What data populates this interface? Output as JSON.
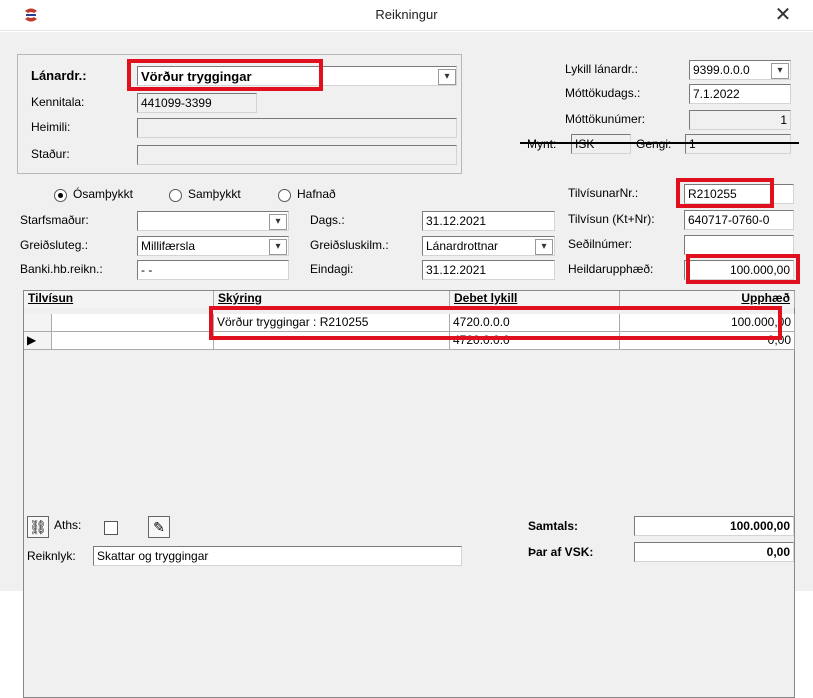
{
  "window": {
    "title": "Reikningur"
  },
  "creditor": {
    "label": "Lánardr.:",
    "value": "Vörður tryggingar",
    "kennitala_label": "Kennitala:",
    "kennitala": "441099-3399",
    "heimili_label": "Heimili:",
    "heimili": "",
    "stadur_label": "Staður:",
    "stadur": ""
  },
  "right_top": {
    "lykill_label": "Lykill lánardr.:",
    "lykill": "9399.0.0.0",
    "mottoku_dags_label": "Móttökudags.:",
    "mottoku_dags": "7.1.2022",
    "mottoku_nr_label": "Móttökunúmer:",
    "mottoku_nr": "1",
    "mynt_label": "Mynt:",
    "mynt": "ISK",
    "gengi_label": "Gengi:",
    "gengi": "1"
  },
  "status": {
    "options": [
      "Ósamþykkt",
      "Samþykkt",
      "Hafnað"
    ],
    "selected": "Ósamþykkt"
  },
  "details": {
    "starfsmadur_label": "Starfsmaður:",
    "starfsmadur": "",
    "greidsluteg_label": "Greiðsluteg.:",
    "greidsluteg": "Millifærsla",
    "banki_label": "Banki.hb.reikn.:",
    "banki": "  -  -",
    "dags_label": "Dags.:",
    "dags": "31.12.2021",
    "greidsluskilm_label": "Greiðsluskilm.:",
    "greidsluskilm": "Lánardrottnar",
    "eindagi_label": "Eindagi:",
    "eindagi": "31.12.2021",
    "tilvisunar_nr_label": "TilvísunarNr.:",
    "tilvisunar_nr": "R210255",
    "tilvisun_kt_label": "Tilvísun (Kt+Nr):",
    "tilvisun_kt": "640717-0760-0",
    "sedil_label": "Seðilnúmer:",
    "sedil": "",
    "heildar_label": "Heildarupphæð:",
    "heildar": "100.000,00"
  },
  "table": {
    "headers": [
      "Tilvísun",
      "Skýring",
      "Debet lykill",
      "Upphæð"
    ],
    "rows": [
      {
        "tilvisun": "",
        "skyring": "Vörður tryggingar : R210255",
        "debet": "4720.0.0.0",
        "upphaed": "100.000,00"
      },
      {
        "tilvisun": "",
        "skyring": "",
        "debet": "4720.0.0.0",
        "upphaed": "0,00"
      }
    ]
  },
  "footer": {
    "aths_label": "Aths:",
    "reiknlyk_label": "Reiknlyk:",
    "reiknlyk": "Skattar og tryggingar",
    "samtals_label": "Samtals:",
    "samtals": "100.000,00",
    "vsk_label": "Þar af VSK:",
    "vsk": "0,00"
  },
  "colors": {
    "highlight": "#e0101e",
    "accent": "#c0392b"
  }
}
